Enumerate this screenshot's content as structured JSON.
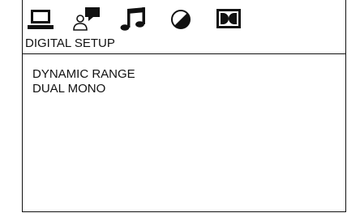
{
  "tabs": [
    {
      "icon": "monitor-icon"
    },
    {
      "icon": "person-speech-icon"
    },
    {
      "icon": "music-note-icon"
    },
    {
      "icon": "contrast-dial-icon"
    },
    {
      "icon": "dolby-icon"
    }
  ],
  "section": {
    "title": "DIGITAL SETUP"
  },
  "menu": {
    "items": [
      {
        "label": "DYNAMIC RANGE"
      },
      {
        "label": "DUAL MONO"
      }
    ]
  }
}
